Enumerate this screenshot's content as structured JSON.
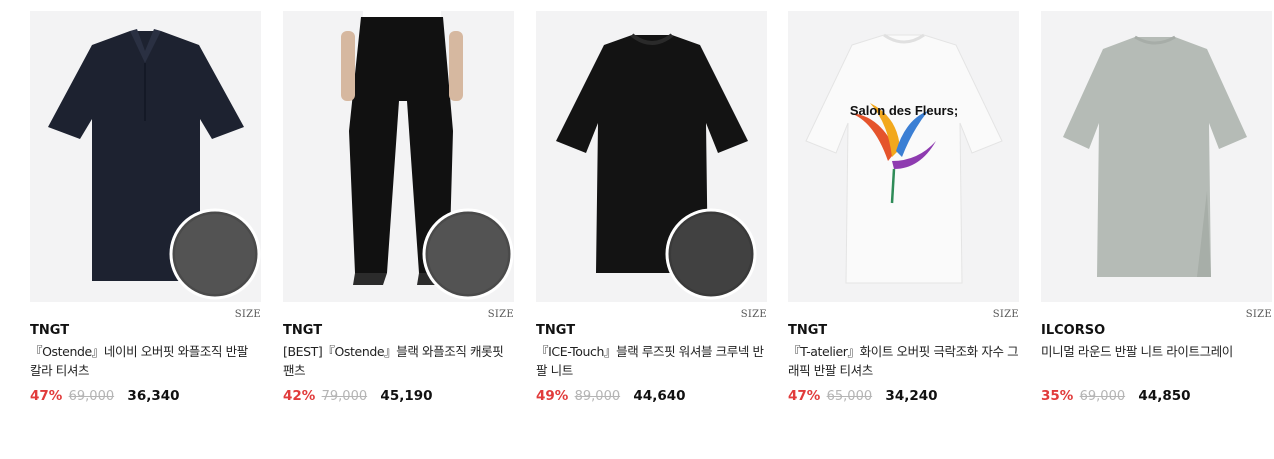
{
  "size_label": "SIZE",
  "colors": {
    "discount": "#e13b3b",
    "original_price": "#b5b5b5",
    "image_bg": "#f3f3f4"
  },
  "products": [
    {
      "brand": "TNGT",
      "title": "『Ostende』네이비 오버핏 와플조직 반팔 칼라 티셔츠",
      "discount": "47%",
      "original_price": "69,000",
      "sale_price": "36,340",
      "image": "navy-collar-polo-shirt-with-fabric-detail"
    },
    {
      "brand": "TNGT",
      "title": "[BEST]『Ostende』블랙 와플조직 캐롯핏 팬츠",
      "discount": "42%",
      "original_price": "79,000",
      "sale_price": "45,190",
      "image": "black-carrot-fit-pants-with-fabric-detail"
    },
    {
      "brand": "TNGT",
      "title": "『ICE-Touch』블랙 루즈핏 워셔블 크루넥 반팔 니트",
      "discount": "49%",
      "original_price": "89,000",
      "sale_price": "44,640",
      "image": "black-crewneck-knit-with-fabric-detail"
    },
    {
      "brand": "TNGT",
      "title": "『T-atelier』화이트 오버핏 극락조화 자수 그래픽 반팔 티셔츠",
      "discount": "47%",
      "original_price": "65,000",
      "sale_price": "34,240",
      "image": "white-graphic-tshirt",
      "graphic_text": "Salon des Fleurs;"
    },
    {
      "brand": "ILCORSO",
      "title": "미니멀 라운드 반팔 니트 라이트그레이",
      "discount": "35%",
      "original_price": "69,000",
      "sale_price": "44,850",
      "image": "light-gray-round-knit"
    }
  ]
}
